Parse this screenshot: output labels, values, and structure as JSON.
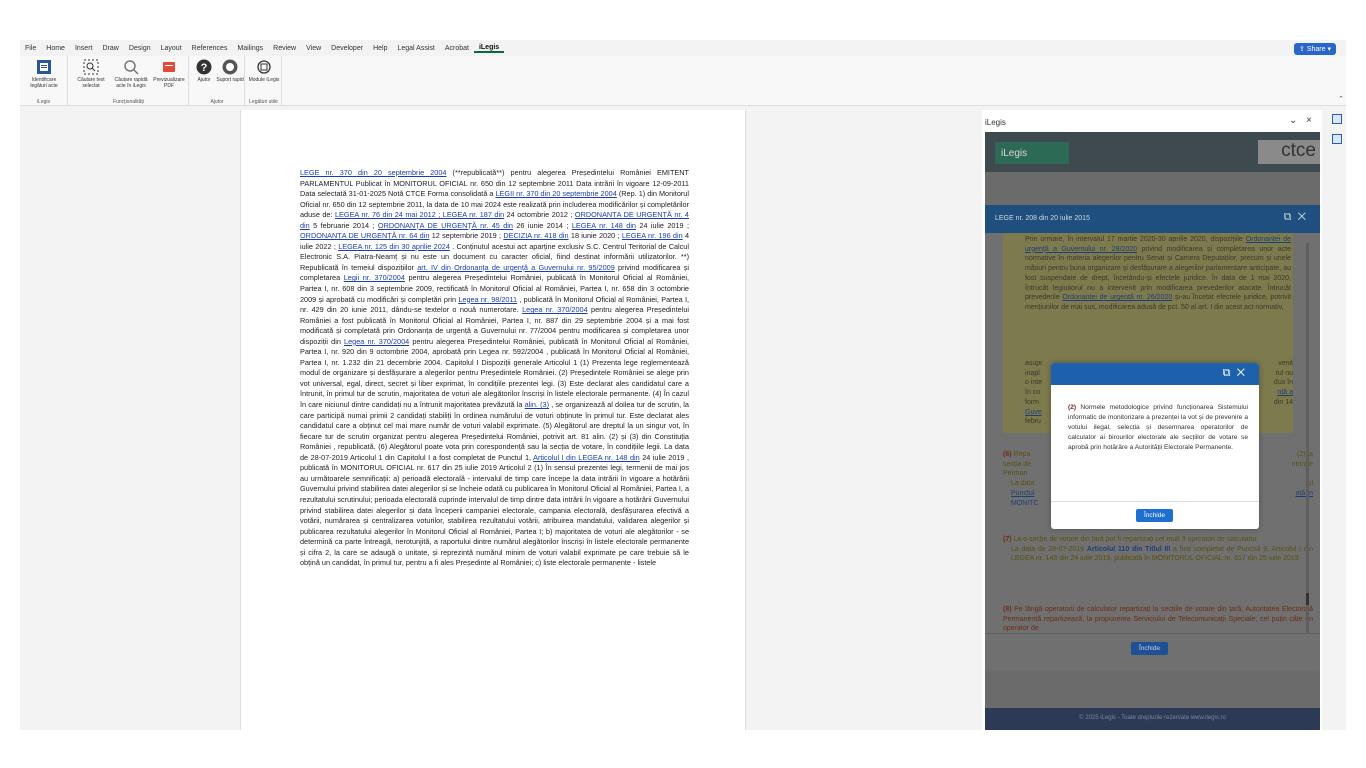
{
  "menu": {
    "tabs": [
      "File",
      "Home",
      "Insert",
      "Draw",
      "Design",
      "Layout",
      "References",
      "Mailings",
      "Review",
      "View",
      "Developer",
      "Help",
      "Legal Assist",
      "Acrobat",
      "iLegis"
    ],
    "active": "iLegis",
    "share_label": "Share"
  },
  "ribbon": {
    "groups": [
      {
        "label": "iLegis",
        "buttons": [
          {
            "label": "Identificare legături acte",
            "icon": "document-link-icon"
          }
        ]
      },
      {
        "label": "Funcționalități",
        "buttons": [
          {
            "label": "Căutare text selectat",
            "icon": "text-search-icon"
          },
          {
            "label": "Căutare rapidă acte în iLegis",
            "icon": "magnifier-icon"
          },
          {
            "label": "Previzualizare PDF",
            "icon": "pdf-icon"
          }
        ]
      },
      {
        "label": "Ajutor",
        "buttons": [
          {
            "label": "Ajutor",
            "icon": "help-icon"
          },
          {
            "label": "Suport rapid",
            "icon": "support-icon"
          }
        ]
      },
      {
        "label": "Legături utile",
        "buttons": [
          {
            "label": "Module iLegis",
            "icon": "modules-icon"
          }
        ]
      }
    ]
  },
  "document": {
    "p1": "LEGE nr. 370 din 20 septembrie 2004",
    "p2": " (**republicată**) pentru alegerea Președintelui României EMITENT PARLAMENTUL Publicat în MONITORUL OFICIAL nr. 650 din 12 septembrie 2011 Data intrării în vigoare 12-09-2011 Data selectată 31-01-2025 Notă CTCE Forma consolidată a ",
    "p3": "LEGII nr. 370 din 20 septembrie 2004",
    "p4": " (Rep. 1) din Monitorul Oficial nr. 650 din 12 septembrie 2011, la data de 10 mai 2024 este realizată prin includerea modificărilor și completărilor aduse de: ",
    "p5": "LEGEA nr. 76 din 24 mai 2012 ; LEGEA nr. 187 din",
    "p6": " 24 octombrie 2012 ; ",
    "p7": "ORDONANȚA DE URGENȚĂ nr. 4 din",
    "p8": " 5 februarie 2014 ; ",
    "p9": "ORDONANȚA DE URGENȚĂ nr. 45 din",
    "p10": " 26 iunie 2014 ; ",
    "p11": "LEGEA nr. 148 din",
    "p12": " 24 iulie 2019 ; ",
    "p13": "ORDONANȚA DE URGENȚĂ nr. 64 din",
    "p14": " 12 septembrie 2019 ; ",
    "p15": "DECIZIA nr. 418 din",
    "p16": " 18 iunie 2020 ; ",
    "p17": "LEGEA nr. 196 din",
    "p18": " 4 iulie 2022 ; ",
    "p19": "LEGEA nr. 125 din 30 aprilie 2024",
    "p20": " . Conținutul acestui act aparține exclusiv S.C. Centrul Teritorial de Calcul Electronic S.A. Piatra-Neamț și nu este un document cu caracter oficial, fiind destinat informării utilizatorilor. **) Republicată în temeiul dispozițiilor ",
    "p21": "art. IV din Ordonanța de urgență a Guvernului nr. 95/2009",
    "p22": " privind modificarea și completarea ",
    "p23": "Legii nr. 370/2004",
    "p24": " pentru alegerea Președintelui României, publicată în Monitorul Oficial al României, Partea I, nr. 608 din 3 septembrie 2009, rectificată în Monitorul Oficial al României, Partea I, nr. 658 din 3 octombrie 2009 și aprobată cu modificări și completări prin ",
    "p25": "Legea nr. 98/2011",
    "p26": " , publicată în Monitorul Oficial al României, Partea I, nr. 429 din 20 iunie 2011, dându-se textelor o nouă numerotare. ",
    "p27": "Legea nr. 370/2004",
    "p28": " pentru alegerea Președintelui României a fost publicată în Monitorul Oficial al României, Partea I, nr. 887 din 29 septembrie 2004 și a mai fost modificată și completată prin Ordonanța de urgență a Guvernului nr. 77/2004 pentru modificarea și completarea unor dispoziții din ",
    "p29": "Legea nr. 370/2004",
    "p30": " pentru alegerea Președintelui României, publicată în Monitorul Oficial al României, Partea I, nr. 920 din 9 octombrie 2004, aprobată prin Legea nr. 592/2004 , publicată în Monitorul Oficial al României, Partea I, nr. 1.232 din 21 decembrie 2004. Capitolul I Dispoziții generale Articolul 1 (1) Prezenta lege reglementează modul de organizare și desfășurare a alegerilor pentru Președintele României. (2) Președintele României se alege prin vot universal, egal, direct, secret și liber exprimat, în condițiile prezentei legi. (3) Este declarat ales candidatul care a întrunit, în primul tur de scrutin, majoritatea de voturi ale alegătorilor înscriși în listele electorale permanente. (4) În cazul în care niciunul dintre candidați nu a întrunit majoritatea prevăzută la ",
    "p31": "alin. (3)",
    "p32": " , se organizează al doilea tur de scrutin, la care participă numai primii 2 candidați stabiliți în ordinea numărului de voturi obținute în primul tur. Este declarat ales candidatul care a obținut cel mai mare număr de voturi valabil exprimate. (5) Alegătorul are dreptul la un singur vot, în fiecare tur de scrutin organizat pentru alegerea Președintelui României, potrivit art. 81 alin. (2) și (3) din Constituția României , republicată. (6) Alegătorul poate vota prin corespondență sau la secția de votare, în condițiile legii. La data de 28-07-2019 Articolul 1 din Capitolul I a fost completat de Punctul 1, ",
    "p33": "Articolul I din LEGEA nr. 148 din",
    "p34": " 24 iulie 2019 , publicată în MONITORUL OFICIAL nr. 617 din 25 iulie 2019 Articolul 2 (1) În sensul prezentei legi, termenii de mai jos au următoarele semnificații: a) perioadă electorală - intervalul de timp care începe la data intrării în vigoare a hotărârii Guvernului privind stabilirea datei alegerilor și se încheie odată cu publicarea în Monitorul Oficial al României, Partea I, a rezultatului scrutinului; perioada electorală cuprinde intervalul de timp dintre data intrării în vigoare a hotărârii Guvernului privind stabilirea datei alegerilor și data începerii campaniei electorale, campania electorală, desfășurarea efectivă a votării, numărarea și centralizarea voturilor, stabilirea rezultatului votării, atribuirea mandatului, validarea alegerilor și publicarea rezultatului alegerilor în Monitorul Oficial al României, Partea I; b) majoritatea de voturi ale alegătorilor - se determină ca parte întreagă, nerotunjită, a raportului dintre numărul alegătorilor înscriși în listele electorale permanente și cifra 2, la care se adaugă o unitate, și reprezintă numărul minim de voturi valabil exprimate pe care trebuie să le obțină un candidat, în primul tur, pentru a fi ales Președinte al României; c) liste electorale permanente - listele"
  },
  "pane": {
    "title": "iLegis",
    "logo": "iLegis",
    "ctce": "ctce",
    "dialog_title": "LEGE nr. 208 din 20 iulie 2015",
    "body1": "Prin urmare, în intervalul 17 martie 2020-30 aprilie 2020, dispozițiile ",
    "body1_link": "Ordonanței de urgență a Guvernului nr. 28/2020",
    "body1b": " privind modificarea și completarea unor acte normative în materia alegerilor pentru Senat și Camera Deputaților, precum și unele măsuri pentru buna organizare și desfășurare a alegerilor parlamentare anticipate, au fost suspendate de drept, încetându-și efectele juridice. În data de 1 mai 2020, întrucât legiuitorul nu a intervenit prin modificarea prevederilor atacate.",
    "body2": "Întrucât prevederile ",
    "body2_link": "Ordonanței de urgență nr. 26/2020",
    "body2b": " și-au încetat efectele juridice, potrivit mențiunilor de mai sus, modificarea adusă de pct. 50 al art. I din acest act normativ,",
    "left_frag": [
      "asupr",
      "inapl",
      "o inte",
      "în co",
      "form",
      "Guve",
      "febru"
    ],
    "right_frag": [
      "venit",
      "rul nu",
      "",
      "dus în",
      "nță a",
      "din 14",
      ""
    ],
    "p6_num": "(6)",
    "p6_start": "Repa",
    "p6_end": "(2) la",
    "p6_l2": "secția de",
    "p6_l2r": "ntorale",
    "p6_l3": "Perman",
    "p6_note_a": "La data",
    "p6_note_b": "Punctul",
    "p6_note_c": "MONITC",
    "p6_note_ra": "ul",
    "p6_note_rb": "ată în",
    "p7_num": "(7)",
    "p7_text": "La o secție de votare din țară pot fi repartizați cel mult 3 operatori de calculator.",
    "p7_note": "La data de 28-07-2019 ",
    "p7_note_bold": "Articolul 110 din Titlul III",
    "p7_note_b": " a fost completat de Punctul 9, Articolul I din LEGEA nr. 148 din 24 iulie 2019, publicată în MONITORUL OFICIAL nr. 617 din 25 iulie 2019",
    "p8_num": "(8)",
    "p8_text": "Pe lângă operatorii de calculator repartizați la secțiile de votare din țară, Autoritatea Electorală Permanentă repartizează, la propunerea Serviciului de Telecomunicații Speciale, cel puțin câte un operator de",
    "close_label": "Închide",
    "footer": "© 2025 iLegis - Toate drepturile rezervate www.ilegis.ro"
  },
  "popup": {
    "num": "(2)",
    "text": " Normele metodologice privind funcționarea Sistemului informatic de monitorizare a prezenței la vot și de prevenire a votului ilegal, selecția și desemnarea operatorilor de calculator ai birourilor electorale ale secțiilor de votare se aprobă prin hotărâre a Autorității Electorale Permanente.",
    "close_label": "Închide"
  }
}
